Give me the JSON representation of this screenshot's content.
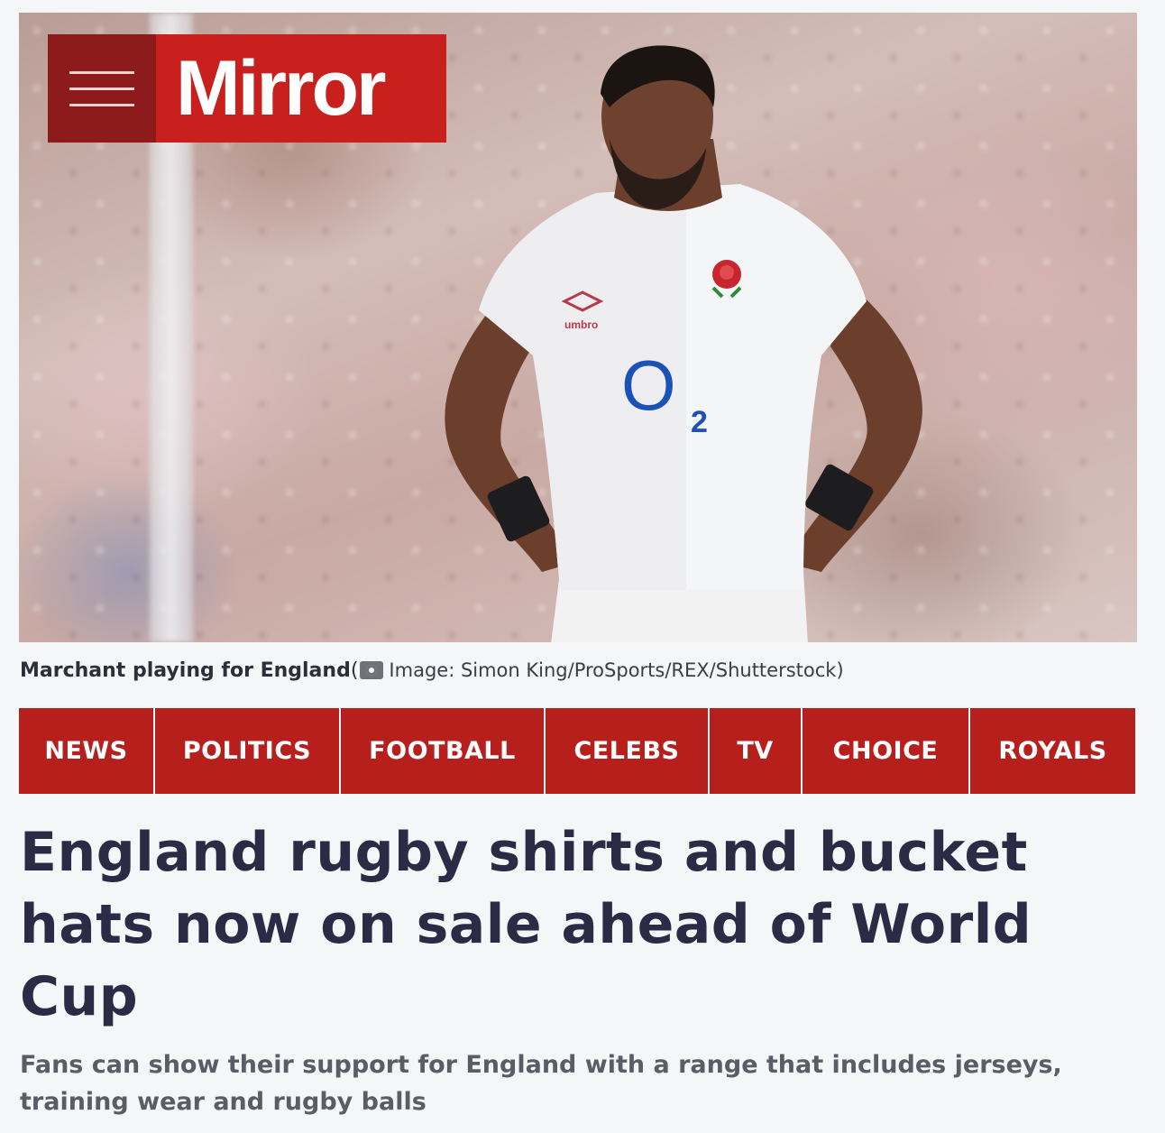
{
  "brand": {
    "name": "Mirror",
    "menu_icon": "hamburger-menu-icon"
  },
  "hero": {
    "caption_title": "Marchant playing for England",
    "caption_open": " (",
    "caption_credit": "Image: Simon King/ProSports/REX/Shutterstock)",
    "shirt_brand": "umbro",
    "sponsor": "O",
    "sponsor_sub": "2"
  },
  "nav": {
    "items": [
      "NEWS",
      "POLITICS",
      "FOOTBALL",
      "CELEBS",
      "TV",
      "CHOICE",
      "ROYALS"
    ]
  },
  "article": {
    "headline": "England rugby shirts and bucket hats now on sale ahead of World Cup",
    "standfirst": "Fans can show their support for England with a range that includes jerseys, training wear and rugby balls"
  },
  "colors": {
    "brand_red": "#c8201d",
    "menu_dark_red": "#8e1b1b",
    "headline": "#2b2b45"
  }
}
